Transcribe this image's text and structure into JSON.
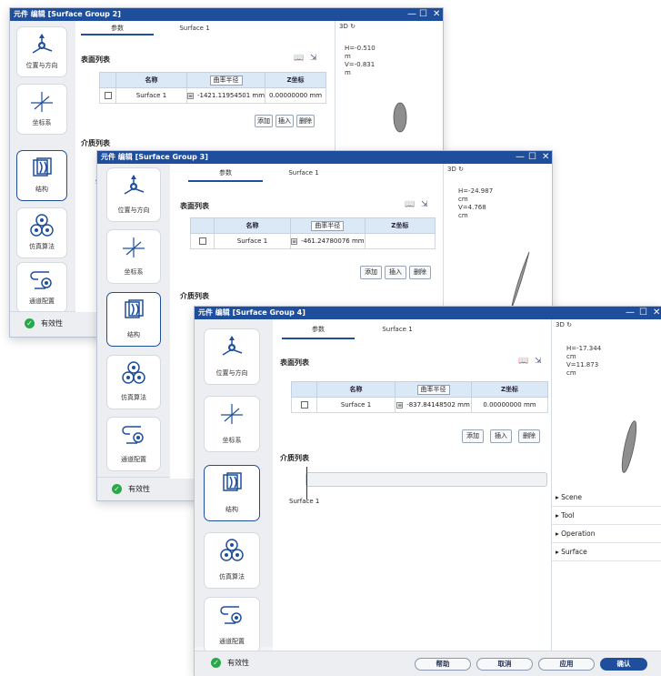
{
  "windows": {
    "w1": {
      "title": "元件 编辑 [Surface Group 2]",
      "tabs": [
        "参数",
        "Surface 1"
      ],
      "surface_section": "表面列表",
      "medium_section": "介质列表",
      "table": {
        "col_name": "名称",
        "col_radius": "曲率半径",
        "col_z": "Z坐标",
        "row_name": "Surface 1",
        "row_radius": "-1421.11954501 mm",
        "row_z": "0.00000000 mm"
      },
      "buttons": [
        "添加",
        "插入",
        "删除"
      ],
      "view3d_label": "3D",
      "view3d_info": "H=-0.510\nm\nV=-0.831\nm",
      "stray_char": "S",
      "validity": "有效性"
    },
    "w2": {
      "title": "元件 编辑 [Surface Group 3]",
      "tabs": [
        "参数",
        "Surface 1"
      ],
      "surface_section": "表面列表",
      "medium_section": "介质列表",
      "table": {
        "col_name": "名称",
        "col_radius": "曲率半径",
        "col_z": "Z坐标",
        "row_name": "Surface 1",
        "row_radius": "-461.24780076 mm",
        "row_z": ""
      },
      "buttons": [
        "添加",
        "插入",
        "删除"
      ],
      "view3d_label": "3D",
      "view3d_info": "H=-24.987\ncm\nV=4.768\ncm",
      "validity": "有效性"
    },
    "w3": {
      "title": "元件 编辑 [Surface Group 4]",
      "tabs": [
        "参数",
        "Surface 1"
      ],
      "surface_section": "表面列表",
      "medium_section": "介质列表",
      "table": {
        "col_name": "名称",
        "col_radius": "曲率半径",
        "col_z": "Z坐标",
        "row_name": "Surface 1",
        "row_radius": "-837.84148502 mm",
        "row_z": "0.00000000 mm"
      },
      "buttons": [
        "添加",
        "插入",
        "删除"
      ],
      "medium_surface_label": "Surface 1",
      "view3d_label": "3D",
      "view3d_info": "H=-17.344\ncm\nV=11.873\ncm",
      "properties": [
        "Scene",
        "Tool",
        "Operation",
        "Surface"
      ],
      "validity": "有效性",
      "dialog_buttons": {
        "help": "帮助",
        "cancel": "取消",
        "apply": "应用",
        "ok": "确认"
      }
    }
  },
  "sidebar": {
    "items": [
      {
        "label": "位置与方向",
        "icon": "position-direction-icon"
      },
      {
        "label": "坐标系",
        "icon": "coordinate-system-icon"
      },
      {
        "label": "结构",
        "icon": "structure-icon"
      },
      {
        "label": "仿真算法",
        "icon": "simulation-algorithm-icon"
      },
      {
        "label": "通道配置",
        "icon": "channel-config-icon"
      }
    ]
  },
  "window_controls": {
    "minimize": "—",
    "maximize": "☐",
    "close": "✕"
  },
  "colors": {
    "titlebar": "#1f4f9c",
    "accent": "#1f4f9c",
    "valid_green": "#29a84a",
    "table_header": "#dbe8f6"
  }
}
